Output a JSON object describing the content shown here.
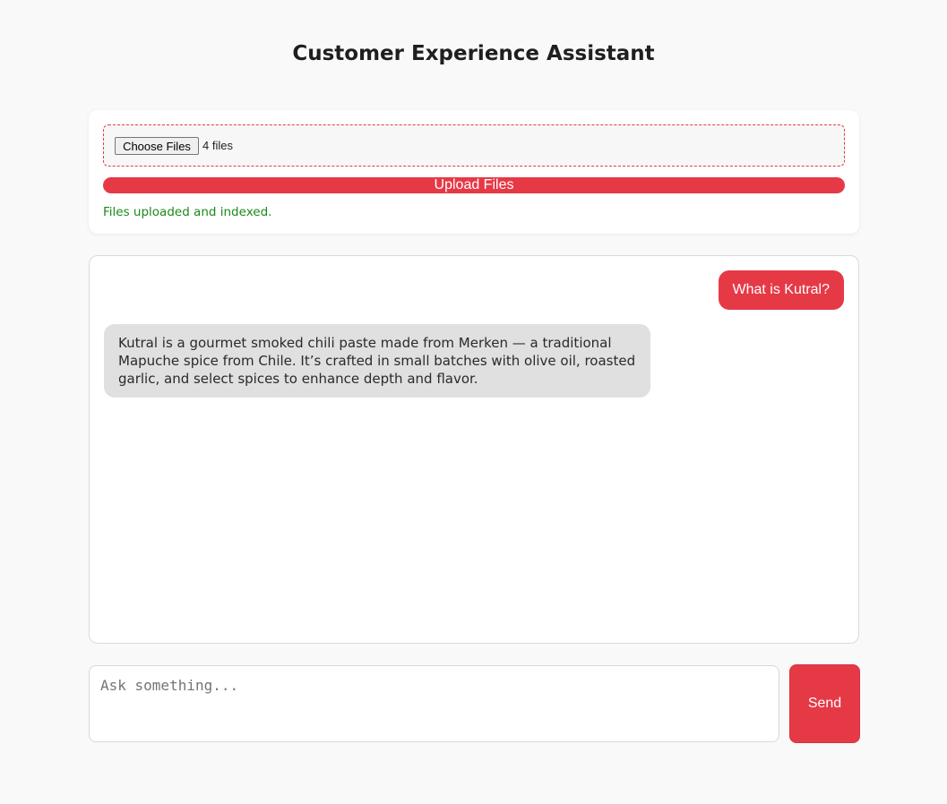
{
  "header": {
    "title": "Customer Experience Assistant"
  },
  "upload": {
    "choose_label": "Choose Files",
    "file_count": "4 files",
    "upload_label": "Upload Files",
    "status": "Files uploaded and indexed."
  },
  "chat": {
    "messages": [
      {
        "role": "user",
        "text": "What is Kutral?"
      },
      {
        "role": "assistant",
        "text": "Kutral is a gourmet smoked chili paste made from Merken — a traditional Mapuche spice from Chile. It’s crafted in small batches with olive oil, roasted garlic, and select spices to enhance depth and flavor."
      }
    ]
  },
  "composer": {
    "placeholder": "Ask something...",
    "value": "",
    "send_label": "Send"
  },
  "colors": {
    "accent": "#e63946",
    "success": "#1a8a1a",
    "bot_bubble": "#e0e0e0",
    "background": "#f9f9f9"
  }
}
